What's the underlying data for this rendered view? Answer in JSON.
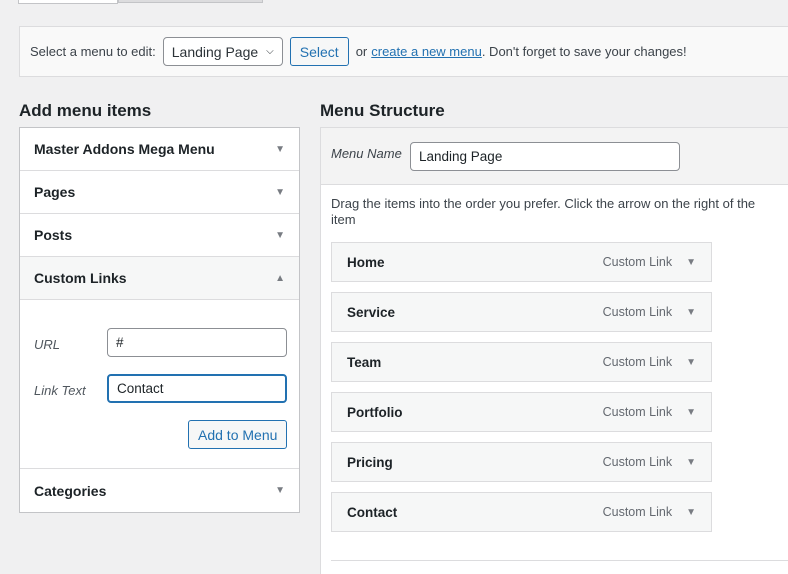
{
  "top": {
    "label": "Select a menu to edit:",
    "selected_menu": "Landing Page",
    "select_button": "Select",
    "or": "or",
    "create_link": "create a new menu",
    "suffix": ". Don't forget to save your changes!"
  },
  "add_items": {
    "title": "Add menu items",
    "sections": [
      {
        "label": "Master Addons Mega Menu"
      },
      {
        "label": "Pages"
      },
      {
        "label": "Posts"
      },
      {
        "label": "Custom Links"
      },
      {
        "label": "Categories"
      }
    ],
    "custom_links": {
      "url_label": "URL",
      "url_value": "#",
      "text_label": "Link Text",
      "text_value": "Contact",
      "add_button": "Add to Menu"
    }
  },
  "structure": {
    "title": "Menu Structure",
    "menu_name_label": "Menu Name",
    "menu_name_value": "Landing Page",
    "instructions": "Drag the items into the order you prefer. Click the arrow on the right of the item",
    "items": [
      {
        "label": "Home",
        "type": "Custom Link"
      },
      {
        "label": "Service",
        "type": "Custom Link"
      },
      {
        "label": "Team",
        "type": "Custom Link"
      },
      {
        "label": "Portfolio",
        "type": "Custom Link"
      },
      {
        "label": "Pricing",
        "type": "Custom Link"
      },
      {
        "label": "Contact",
        "type": "Custom Link"
      }
    ]
  }
}
